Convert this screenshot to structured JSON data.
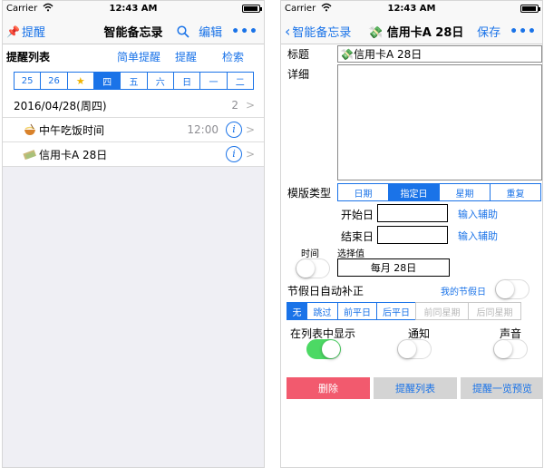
{
  "left": {
    "status": {
      "carrier": "Carrier",
      "time": "12:43 AM"
    },
    "nav": {
      "back_label": "提醒",
      "title": "智能备忘录",
      "edit_label": "编辑",
      "more_label": "•••"
    },
    "subbar": {
      "list_title": "提醒列表",
      "links": [
        "简单提醒",
        "提醒",
        "检索"
      ]
    },
    "days": [
      {
        "label": "25",
        "active": false
      },
      {
        "label": "26",
        "active": false
      },
      {
        "label": "★",
        "active": false,
        "star": true
      },
      {
        "label": "四",
        "active": true
      },
      {
        "label": "五",
        "active": false
      },
      {
        "label": "六",
        "active": false
      },
      {
        "label": "日",
        "active": false
      },
      {
        "label": "一",
        "active": false
      },
      {
        "label": "二",
        "active": false
      }
    ],
    "date_row": {
      "label": "2016/04/28(周四)",
      "count": "2"
    },
    "items": [
      {
        "icon": "noodle-bowl-icon",
        "label": "中午吃饭时间",
        "time": "12:00"
      },
      {
        "icon": "money-bill-icon",
        "label": "信用卡A 28日",
        "time": ""
      }
    ]
  },
  "right": {
    "status": {
      "carrier": "Carrier",
      "time": "12:43 AM"
    },
    "nav": {
      "back_label": "智能备忘录",
      "title": "信用卡A 28日",
      "save_label": "保存",
      "more_label": "•••"
    },
    "title_label": "标题",
    "title_value": "信用卡A 28日",
    "detail_label": "详细",
    "template_label": "模版类型",
    "template_tabs": [
      {
        "label": "日期",
        "active": false
      },
      {
        "label": "指定日",
        "active": true
      },
      {
        "label": "星期",
        "active": false
      },
      {
        "label": "重复",
        "active": false
      }
    ],
    "start_label": "开始日",
    "end_label": "结束日",
    "assist_label": "输入辅助",
    "time_label": "时间",
    "select_label": "选择值",
    "select_value": "每月 28日",
    "holiday_label": "节假日自动补正",
    "my_holiday_label": "我的节假日",
    "adjust_tabs": [
      {
        "label": "无",
        "active": true,
        "disabled": false
      },
      {
        "label": "跳过",
        "active": false,
        "disabled": false
      },
      {
        "label": "前平日",
        "active": false,
        "disabled": false
      },
      {
        "label": "后平日",
        "active": false,
        "disabled": false
      },
      {
        "label": "前同星期",
        "active": false,
        "disabled": true
      },
      {
        "label": "后同星期",
        "active": false,
        "disabled": true
      }
    ],
    "show_in_list_label": "在列表中显示",
    "notify_label": "通知",
    "sound_label": "声音",
    "toggles": {
      "time": false,
      "holiday": false,
      "show_in_list": true,
      "notify": false,
      "sound": false
    },
    "buttons": {
      "delete": "删除",
      "list": "提醒列表",
      "preview": "提醒一览预览"
    }
  },
  "colors": {
    "accent": "#1a73e8",
    "delete": "#f25a6e",
    "toggle_on": "#4cd964"
  }
}
